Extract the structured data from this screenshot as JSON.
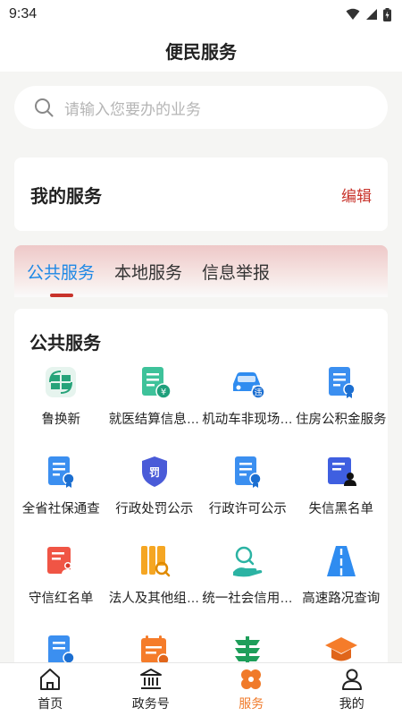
{
  "status_bar": {
    "time": "9:34"
  },
  "header": {
    "title": "便民服务"
  },
  "search": {
    "placeholder": "请输入您要办的业务"
  },
  "my_services": {
    "title": "我的服务",
    "edit_label": "编辑"
  },
  "tabs": [
    {
      "label": "公共服务",
      "active": true
    },
    {
      "label": "本地服务",
      "active": false
    },
    {
      "label": "信息举报",
      "active": false
    }
  ],
  "services": {
    "title": "公共服务",
    "items": [
      {
        "label": "鲁换新",
        "icon": "replace-badge-icon"
      },
      {
        "label": "就医结算信息查询",
        "icon": "medical-bill-icon"
      },
      {
        "label": "机动车非现场违法查询",
        "icon": "car-violation-icon"
      },
      {
        "label": "住房公积金服务",
        "icon": "housing-fund-icon"
      },
      {
        "label": "全省社保通查",
        "icon": "social-security-icon"
      },
      {
        "label": "行政处罚公示",
        "icon": "penalty-shield-icon"
      },
      {
        "label": "行政许可公示",
        "icon": "license-doc-icon"
      },
      {
        "label": "失信黑名单",
        "icon": "blacklist-icon"
      },
      {
        "label": "守信红名单",
        "icon": "redlist-icon"
      },
      {
        "label": "法人及其他组织信息",
        "icon": "legal-person-icon"
      },
      {
        "label": "统一社会信用代码",
        "icon": "credit-search-icon"
      },
      {
        "label": "高速路况查询",
        "icon": "highway-icon"
      },
      {
        "label": "",
        "icon": "doc-badge-icon"
      },
      {
        "label": "",
        "icon": "calendar-icon"
      },
      {
        "label": "",
        "icon": "postal-icon"
      },
      {
        "label": "",
        "icon": "graduation-cap-icon"
      }
    ]
  },
  "bottom_nav": [
    {
      "label": "首页",
      "icon": "home-icon",
      "active": false
    },
    {
      "label": "政务号",
      "icon": "government-building-icon",
      "active": false
    },
    {
      "label": "服务",
      "icon": "services-clover-icon",
      "active": true
    },
    {
      "label": "我的",
      "icon": "user-icon",
      "active": false
    }
  ],
  "colors": {
    "accent_blue": "#1e88e5",
    "accent_red": "#c8332b",
    "accent_orange": "#f07a2a"
  }
}
